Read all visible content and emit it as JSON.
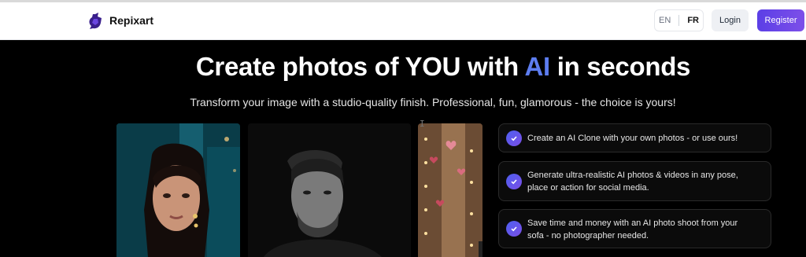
{
  "header": {
    "brand": "Repixart",
    "lang_en": "EN",
    "lang_fr": "FR",
    "login": "Login",
    "register": "Register"
  },
  "hero": {
    "title_pre": "Create photos of YOU with ",
    "title_ai": "AI",
    "title_post": " in seconds",
    "subtitle": "Transform your image with a studio-quality finish. Professional, fun, glamorous - the choice is yours!"
  },
  "features": [
    {
      "line1": "Create an AI Clone with your own photos - or use ours!",
      "line2": ""
    },
    {
      "line1": "Generate ultra-realistic AI photos & videos in any pose,",
      "line2": "place or action for social media."
    },
    {
      "line1": "Save time and money with an AI photo shoot from your",
      "line2": "sofa - no photographer needed."
    }
  ],
  "colors": {
    "accent": "#5d7df0",
    "register_bg": "#6a46e8",
    "background": "#000000"
  },
  "icons": {
    "logo": "repixart-logo-icon",
    "feature_check": "check-circle-icon"
  }
}
